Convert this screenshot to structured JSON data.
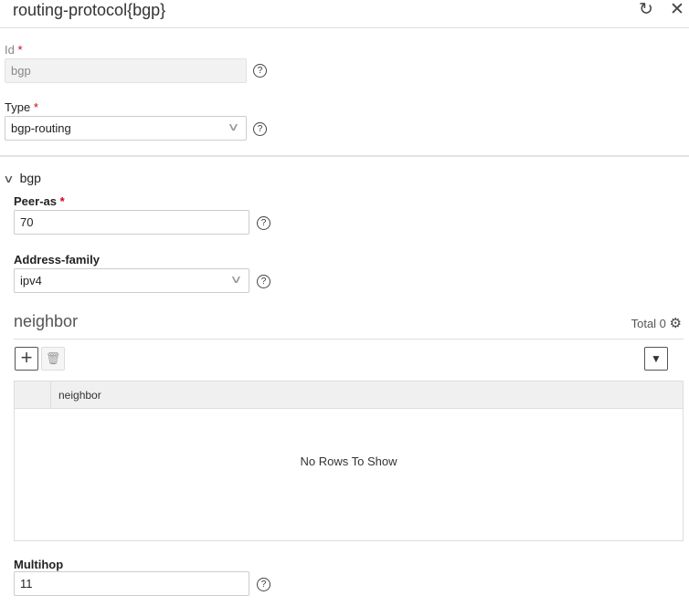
{
  "header": {
    "title": "routing-protocol{bgp}",
    "refresh_icon": "refresh-icon",
    "close_icon": "close-icon"
  },
  "fields": {
    "id": {
      "label": "Id",
      "required": "*",
      "value": "bgp"
    },
    "type": {
      "label": "Type",
      "required": "*",
      "value": "bgp-routing"
    },
    "bgp_section": {
      "label": "bgp"
    },
    "peer_as": {
      "label": "Peer-as",
      "required": "*",
      "value": "70"
    },
    "address_family": {
      "label": "Address-family",
      "value": "ipv4"
    },
    "multihop": {
      "label": "Multihop",
      "value": "11"
    }
  },
  "help_glyph": "?",
  "neighbor": {
    "title": "neighbor",
    "total": "Total 0",
    "columns": [
      "neighbor"
    ],
    "empty": "No Rows To Show"
  }
}
